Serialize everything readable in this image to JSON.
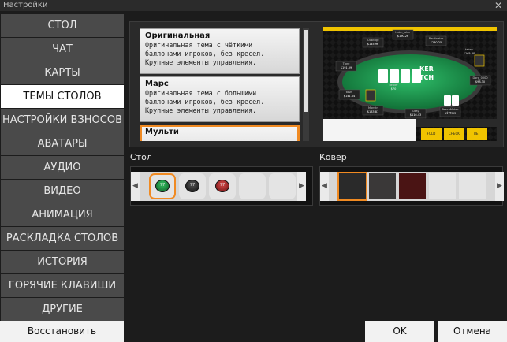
{
  "window": {
    "title": "Настройки",
    "close_glyph": "✕"
  },
  "sidebar": {
    "items": [
      {
        "label": "СТОЛ",
        "active": false
      },
      {
        "label": "ЧАТ",
        "active": false
      },
      {
        "label": "КАРТЫ",
        "active": false
      },
      {
        "label": "ТЕМЫ СТОЛОВ",
        "active": true
      },
      {
        "label": "НАСТРОЙКИ ВЗНОСОВ",
        "active": false
      },
      {
        "label": "АВАТАРЫ",
        "active": false
      },
      {
        "label": "АУДИО",
        "active": false
      },
      {
        "label": "ВИДЕО",
        "active": false
      },
      {
        "label": "АНИМАЦИЯ",
        "active": false
      },
      {
        "label": "РАСКЛАДКА СТОЛОВ",
        "active": false
      },
      {
        "label": "ИСТОРИЯ",
        "active": false
      },
      {
        "label": "ГОРЯЧИЕ КЛАВИШИ",
        "active": false
      },
      {
        "label": "ДРУГИЕ",
        "active": false
      }
    ],
    "restore_label": "Восстановить настройки"
  },
  "themes": [
    {
      "name": "Оригинальная",
      "desc": [
        "Оригинальная тема с чёткими",
        "баллонами игроков, без кресел.",
        "Крупные элементы управления."
      ],
      "selected": false
    },
    {
      "name": "Марс",
      "desc": [
        "Оригинальная тема с большими",
        "баллонами игроков, без кресел.",
        "Крупные элементы управления."
      ],
      "selected": false
    },
    {
      "name": "Мульти",
      "desc": [],
      "selected": true
    }
  ],
  "preview": {
    "logo_text": "KER",
    "logo_text2": "TCH",
    "action_buttons": [
      "FOLD",
      "CHECK",
      "BET"
    ],
    "players": [
      {
        "name": "ILv4kbgc",
        "stack": "$145.96"
      },
      {
        "name": "hatm_joker",
        "stack": "$190.26"
      },
      {
        "name": "Berdinator",
        "stack": "$230.25"
      },
      {
        "name": "Tigre",
        "stack": "$191.09"
      },
      {
        "name": "Dorg_0000",
        "stack": "$98.30"
      },
      {
        "name": "toshi",
        "stack": "$141.64"
      },
      {
        "name": "Monstr",
        "stack": "$183.81"
      },
      {
        "name": "Sisay",
        "stack": "$116.43"
      },
      {
        "name": "PeaceMaker Lucy",
        "stack": "$179.33"
      },
      {
        "name": "dealer",
        "stack": "$70"
      },
      {
        "name": "tabak",
        "stack": "$165.60"
      }
    ]
  },
  "stol": {
    "label": "Стол",
    "chips": [
      {
        "color": "#1b8a3a",
        "text": "77"
      },
      {
        "color": "#2a2a2a",
        "text": "77"
      },
      {
        "color": "#a12a2a",
        "text": "77"
      }
    ],
    "selected_index": 0,
    "arrow_left": "◀",
    "arrow_right": "▶"
  },
  "kover": {
    "label": "Ковёр",
    "rugs": [
      {
        "color": "#2a2a2a"
      },
      {
        "color": "#3a3838"
      },
      {
        "color": "#4a1414"
      },
      {
        "color": "#e4e4e4"
      },
      {
        "color": "#e4e4e4"
      }
    ],
    "selected_index": 0,
    "arrow_left": "◀",
    "arrow_right": "▶"
  },
  "buttons": {
    "ok": "OK",
    "cancel": "Отмена"
  },
  "colors": {
    "accent": "#f08a22",
    "felt": "#1f8a45",
    "background": "#1c1c1c"
  }
}
